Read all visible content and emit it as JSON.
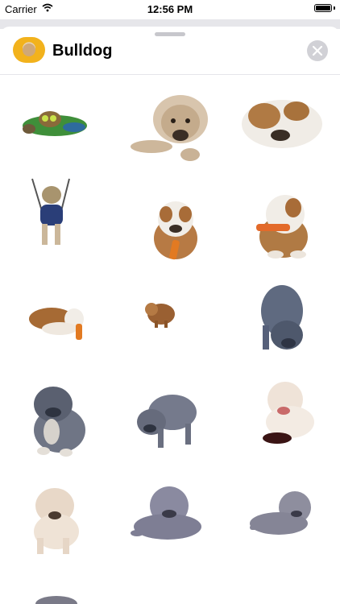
{
  "status_bar": {
    "carrier": "Carrier",
    "time": "12:56 PM"
  },
  "header": {
    "title": "Bulldog",
    "app_icon": "bulldog-app-icon",
    "close_icon": "close-icon"
  },
  "stickers": [
    "bulldog-in-green-shirt-sticker",
    "fawn-bulldog-lying-sticker",
    "brown-white-bulldog-sleeping-sticker",
    "bulldog-in-swing-harness-sticker",
    "bulldog-puppy-with-carrot-sticker",
    "bulldog-puppy-with-toy-sticker",
    "bulldog-lying-with-carrot-sticker",
    "small-brown-puppy-sticker",
    "blue-bulldog-standing-sticker",
    "blue-bulldog-sitting-sticker",
    "blue-bulldog-walking-sticker",
    "white-bulldog-puppy-sticker",
    "cream-wrinkly-puppy-sticker",
    "gray-wrinkly-dog-lying-sticker",
    "gray-wrinkly-puppy-lying-sticker",
    "partially-visible-sticker"
  ]
}
